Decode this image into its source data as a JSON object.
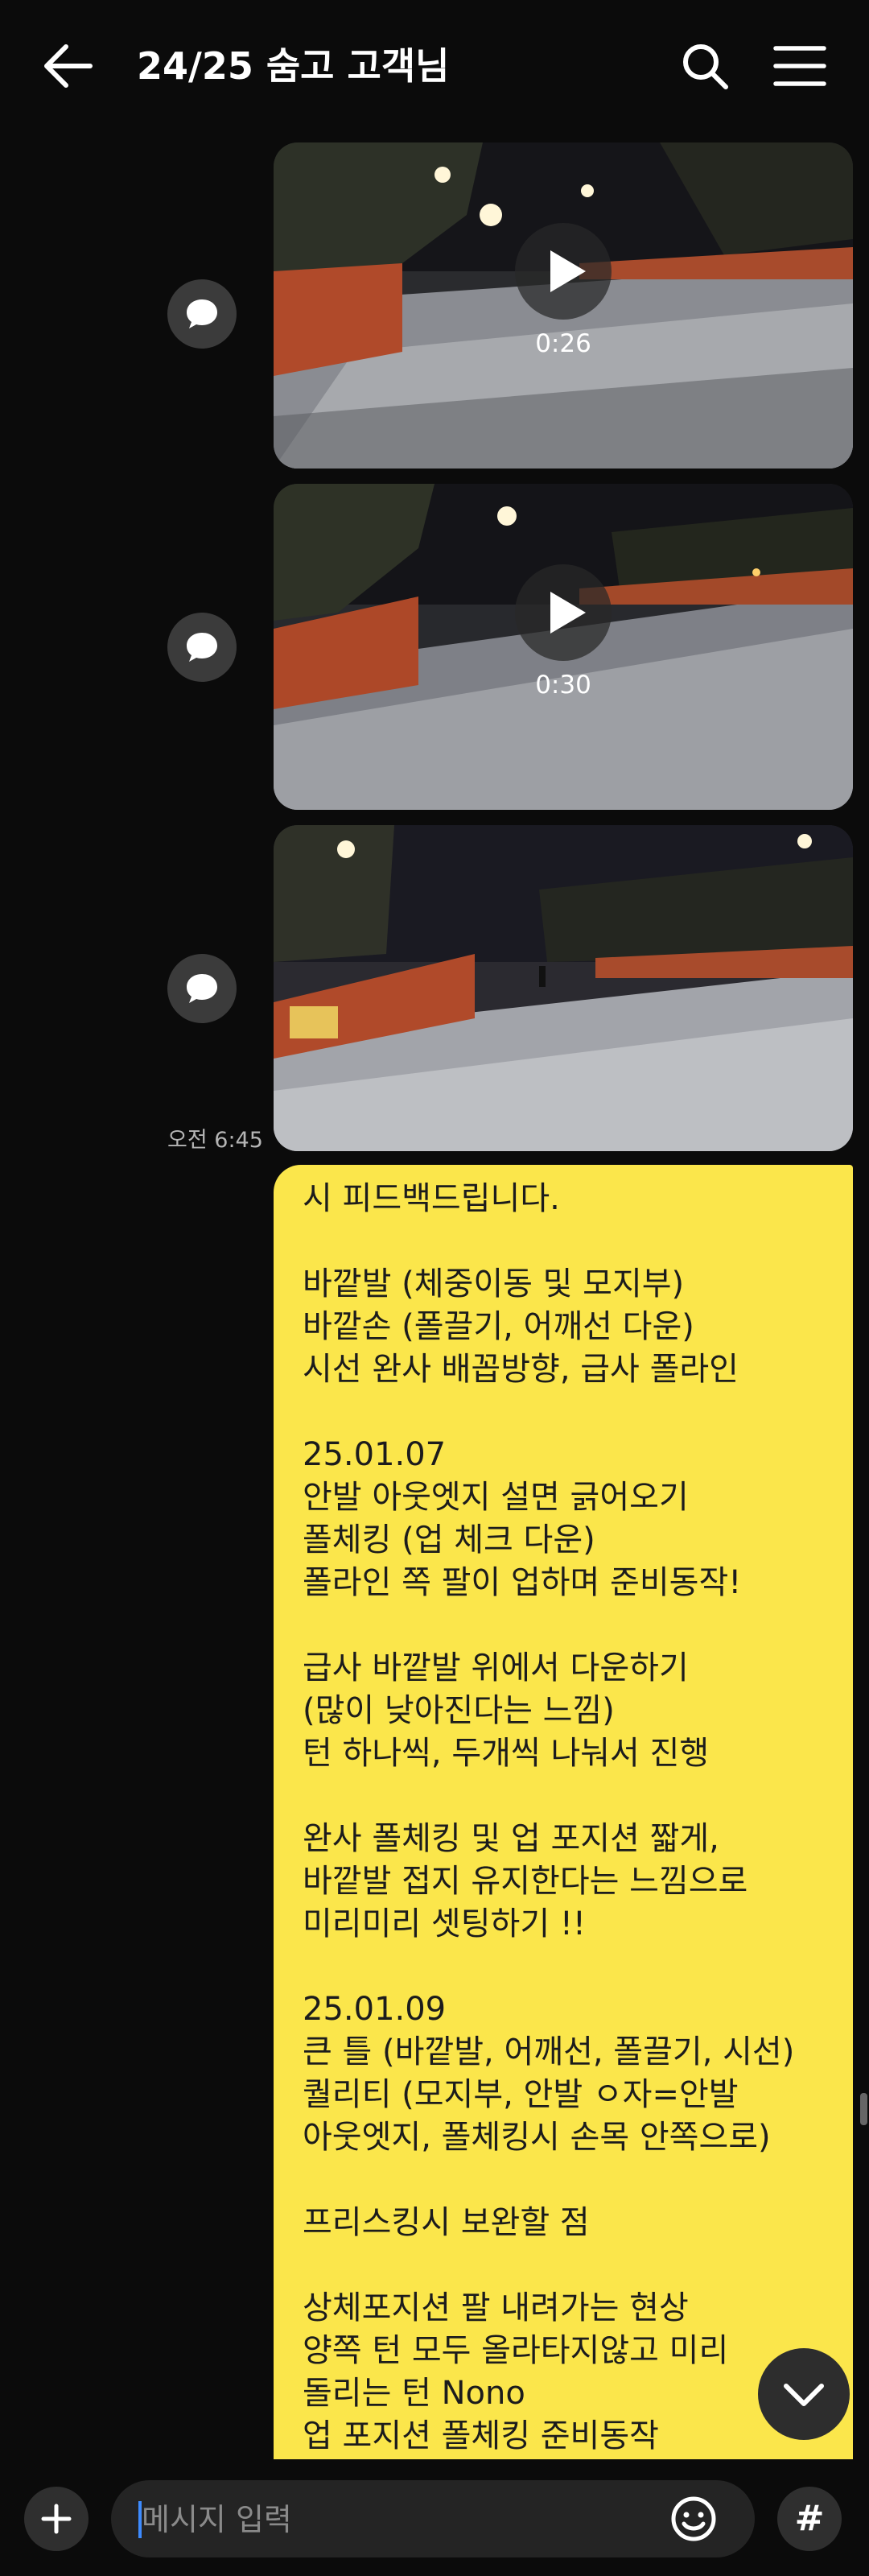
{
  "header": {
    "title": "24/25 숨고 고객님",
    "back_icon": "arrow-left-icon",
    "search_icon": "search-icon",
    "menu_icon": "hamburger-menu-icon"
  },
  "media": [
    {
      "type": "video",
      "duration": "0:26",
      "comment_icon": "speech-bubble-icon"
    },
    {
      "type": "video",
      "duration": "0:30",
      "comment_icon": "speech-bubble-icon"
    },
    {
      "type": "photo",
      "comment_icon": "speech-bubble-icon"
    }
  ],
  "timestamp": "오전 6:45",
  "message": {
    "bubble_color": "#fbe64b",
    "lines": [
      "시 피드백드립니다.",
      "",
      "바깥발 (체중이동 및 모지부)",
      "바깥손 (폴끌기, 어깨선 다운)",
      "시선 완사 배꼽방향, 급사 폴라인",
      "",
      "25.01.07",
      "안발 아웃엣지 설면 긁어오기",
      "폴체킹 (업 체크 다운)",
      "폴라인 쪽 팔이 업하며 준비동작!",
      "",
      "급사 바깥발 위에서 다운하기",
      "(많이 낮아진다는 느낌)",
      "턴 하나씩, 두개씩 나눠서 진행",
      "",
      "완사 폴체킹 및 업 포지션 짧게,",
      "바깥발 접지 유지한다는 느낌으로",
      "미리미리 셋팅하기 !!",
      "",
      "25.01.09",
      "큰 틀 (바깥발, 어깨선, 폴끌기, 시선)",
      "퀄리티 (모지부, 안발 ㅇ자=안발",
      "아웃엣지, 폴체킹시 손목 안쪽으로)",
      "",
      "프리스킹시 보완할 점",
      "",
      "상체포지션 팔 내려가는 현상",
      "양쪽 턴 모두 올라타지않고 미리",
      "돌리는 턴 Nono",
      "업 포지션 폴체킹 준비동작"
    ]
  },
  "composer": {
    "placeholder": "메시지 입력",
    "plus_icon": "plus-icon",
    "emoji_icon": "emoji-icon",
    "hash_label": "#"
  },
  "scroll_down_icon": "chevron-down-icon"
}
